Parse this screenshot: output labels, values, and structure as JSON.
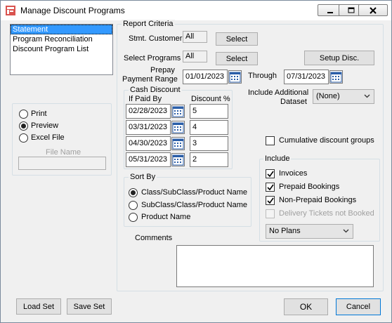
{
  "window": {
    "title": "Manage Discount Programs"
  },
  "report_list": {
    "items": [
      "Statement",
      "Program Reconciliation",
      "Discount Program List"
    ],
    "selected": "Statement"
  },
  "output": {
    "options": [
      "Print",
      "Preview",
      "Excel File"
    ],
    "selected": "Preview",
    "file_name_label": "File Name",
    "file_name_value": ""
  },
  "criteria": {
    "group_label": "Report Criteria",
    "stmt_customer_label": "Stmt. Customer",
    "stmt_customer_value": "All",
    "select_programs_label": "Select Programs",
    "select_programs_value": "All",
    "select_label": "Select",
    "setup_disc_label": "Setup Disc.",
    "prepay_label_line1": "Prepay",
    "prepay_label_line2": "Payment Range",
    "prepay_from": "01/01/2023",
    "through_label": "Through",
    "prepay_to": "07/31/2023",
    "include_additional_line1": "Include Additional",
    "include_additional_line2": "Dataset",
    "dataset_value": "(None)"
  },
  "cash_discount": {
    "group_label": "Cash Discount",
    "col_paid_by": "If Paid By",
    "col_discount": "Discount %",
    "rows": [
      {
        "date": "02/28/2023",
        "percent": "5"
      },
      {
        "date": "03/31/2023",
        "percent": "4"
      },
      {
        "date": "04/30/2023",
        "percent": "3"
      },
      {
        "date": "05/31/2023",
        "percent": "2"
      }
    ]
  },
  "sort_by": {
    "group_label": "Sort By",
    "options": [
      "Class/SubClass/Product Name",
      "SubClass/Class/Product Name",
      "Product Name"
    ],
    "selected": "Class/SubClass/Product Name"
  },
  "cumulative": {
    "label": "Cumulative discount groups",
    "checked": false
  },
  "include": {
    "group_label": "Include",
    "items": [
      {
        "label": "Invoices",
        "checked": true,
        "enabled": true
      },
      {
        "label": "Prepaid Bookings",
        "checked": true,
        "enabled": true
      },
      {
        "label": "Non-Prepaid Bookings",
        "checked": true,
        "enabled": true
      },
      {
        "label": "Delivery Tickets not Booked",
        "checked": false,
        "enabled": false
      }
    ],
    "plans_value": "No Plans"
  },
  "comments": {
    "label": "Comments",
    "value": ""
  },
  "footer": {
    "load_set": "Load Set",
    "save_set": "Save Set",
    "ok": "OK",
    "cancel": "Cancel"
  }
}
